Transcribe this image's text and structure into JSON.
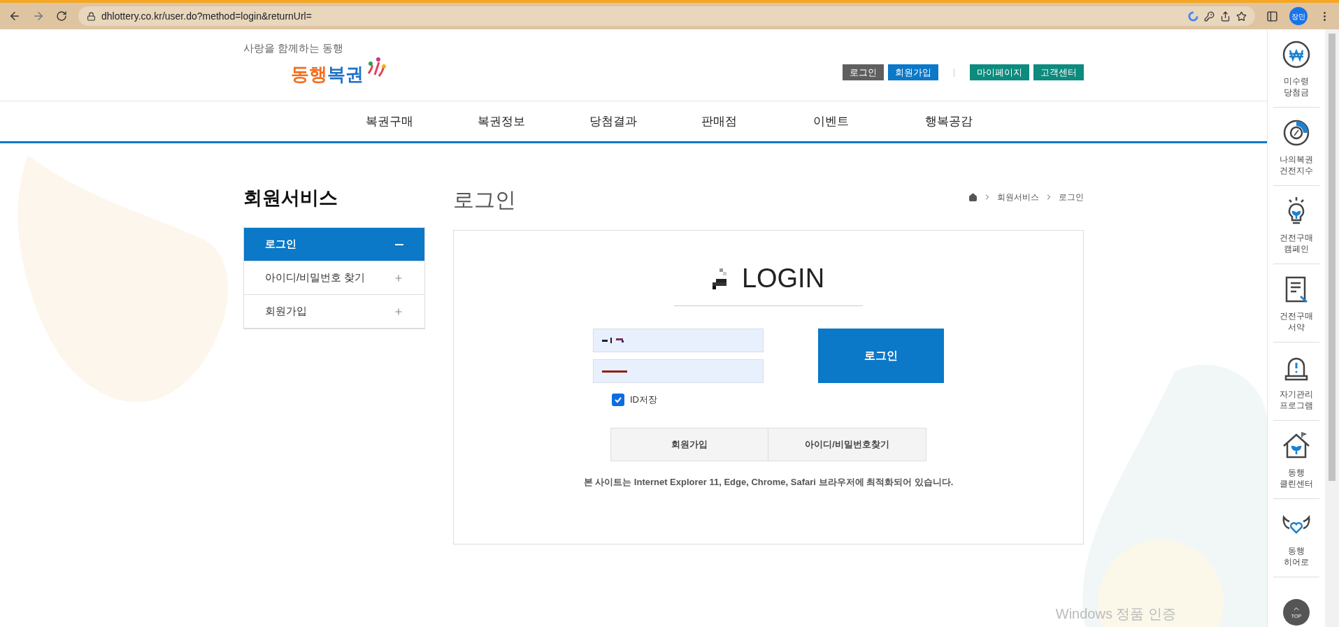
{
  "browser": {
    "url": "dhlottery.co.kr/user.do?method=login&returnUrl=",
    "profile": "장민"
  },
  "header": {
    "tagline": "사랑을 함께하는 동행",
    "logo": [
      {
        "text": "동행",
        "color": "#f26f1e"
      },
      {
        "text": "복권",
        "color": "#1d71c6"
      }
    ],
    "buttons": [
      {
        "label": "로그인",
        "kind": "dark"
      },
      {
        "label": "회원가입",
        "kind": "blue"
      },
      {
        "label": "마이페이지",
        "kind": "teal"
      },
      {
        "label": "고객센터",
        "kind": "teal"
      }
    ]
  },
  "nav": [
    "복권구매",
    "복권정보",
    "당첨결과",
    "판매점",
    "이벤트",
    "행복공감"
  ],
  "sidebar": {
    "title": "회원서비스",
    "items": [
      {
        "label": "로그인",
        "selected": true
      },
      {
        "label": "아이디/비밀번호 찾기",
        "selected": false
      },
      {
        "label": "회원가입",
        "selected": false
      }
    ]
  },
  "page": {
    "title": "로그인",
    "breadcrumb": [
      "회원서비스",
      "로그인"
    ]
  },
  "login": {
    "heading": "LOGIN",
    "button": "로그인",
    "save_id": {
      "label": "ID저장",
      "checked": true
    },
    "links": [
      "회원가입",
      "아이디/비밀번호찾기"
    ],
    "notice": "본 사이트는 Internet Explorer 11, Edge, Chrome, Safari 브라우저에 최적화되어 있습니다."
  },
  "quick_menu": [
    {
      "kind": "won",
      "lines": [
        "미수령",
        "당첨금"
      ]
    },
    {
      "kind": "percent",
      "lines": [
        "나의복권",
        "건전지수"
      ]
    },
    {
      "kind": "bulb",
      "lines": [
        "건전구매",
        "캠페인"
      ]
    },
    {
      "kind": "document",
      "lines": [
        "건전구매",
        "서약"
      ]
    },
    {
      "kind": "alarm",
      "lines": [
        "자기관리",
        "프로그램"
      ]
    },
    {
      "kind": "house",
      "lines": [
        "동행",
        "클린센터"
      ]
    },
    {
      "kind": "heart",
      "lines": [
        "동행",
        "히어로"
      ]
    }
  ],
  "top_button": "TOP",
  "os_notice": "Windows 정품 인증"
}
